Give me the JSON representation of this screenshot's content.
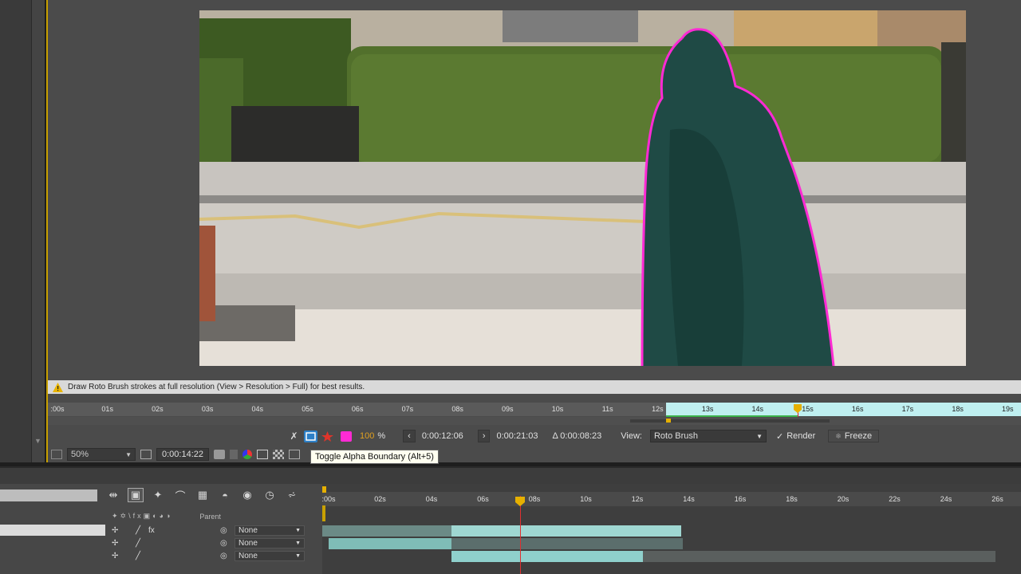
{
  "warning": {
    "text": "Draw Roto Brush strokes at full resolution (View > Resolution > Full) for best results."
  },
  "layer_ruler": {
    "ticks": [
      ":00s",
      "01s",
      "02s",
      "03s",
      "04s",
      "05s",
      "06s",
      "07s",
      "08s",
      "09s",
      "10s",
      "11s",
      "12s",
      "13s",
      "14s",
      "15s",
      "16s",
      "17s",
      "18s",
      "19s"
    ]
  },
  "roto_controls": {
    "opacity_value": "100",
    "opacity_unit": "%",
    "start_time": "0:00:12:06",
    "end_time": "0:00:21:03",
    "duration": "Δ 0:00:08:23",
    "view_label": "View:",
    "view_value": "Roto Brush",
    "render_label": "Render",
    "freeze_label": "Freeze"
  },
  "viewer_toolbar": {
    "zoom": "50%",
    "current_time": "0:00:14:22"
  },
  "tooltip": {
    "text": "Toggle Alpha Boundary (Alt+5)"
  },
  "timeline": {
    "ruler_ticks": [
      ":00s",
      "02s",
      "04s",
      "06s",
      "08s",
      "10s",
      "12s",
      "14s",
      "16s",
      "18s",
      "20s",
      "22s",
      "24s",
      "26s"
    ],
    "column_parent": "Parent",
    "layers": [
      {
        "parent": "None"
      },
      {
        "parent": "None"
      },
      {
        "parent": "None"
      }
    ]
  },
  "colors": {
    "alpha_boundary": "#ff2ad4",
    "accent_cyan": "#8fd0cc",
    "work_area": "#bfeff0",
    "cti": "#e6b000"
  }
}
